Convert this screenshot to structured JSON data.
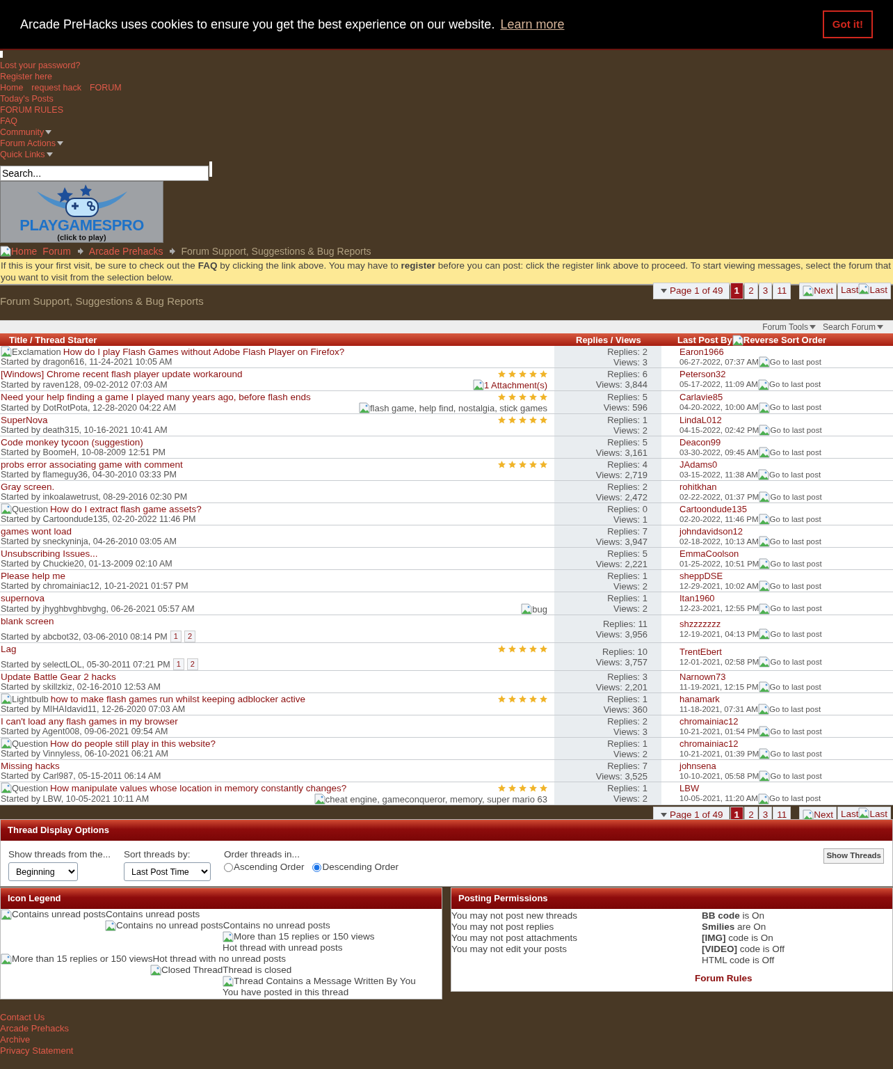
{
  "cookie_bar": {
    "message": "Arcade PreHacks uses cookies to ensure you get the best experience on our website.",
    "link": "Learn more",
    "button": "Got it!"
  },
  "nav_rows": [
    {
      "items": [
        {
          "label": "Lost your password?",
          "kind": "link"
        }
      ]
    },
    {
      "items": [
        {
          "label": "Register here",
          "kind": "link"
        }
      ]
    },
    {
      "items": [
        {
          "label": "Home",
          "kind": "link"
        },
        {
          "label": "request hack",
          "kind": "link"
        },
        {
          "label": "FORUM",
          "kind": "link"
        }
      ]
    },
    {
      "items": [
        {
          "label": "Today's Posts",
          "kind": "link"
        }
      ]
    },
    {
      "items": [
        {
          "label": "FORUM RULES",
          "kind": "link"
        }
      ]
    },
    {
      "items": [
        {
          "label": "FAQ",
          "kind": "link"
        }
      ]
    },
    {
      "items": [
        {
          "label": "Community",
          "kind": "menu"
        }
      ]
    },
    {
      "items": [
        {
          "label": "Forum Actions",
          "kind": "menu"
        }
      ]
    },
    {
      "items": [
        {
          "label": "Quick Links",
          "kind": "menu"
        }
      ]
    }
  ],
  "search": {
    "placeholder": "Search..."
  },
  "logo": {
    "title": "PLAYGAMESPRO",
    "subtitle": "(click to play)"
  },
  "breadcrumb": [
    {
      "label": "Home",
      "current": false
    },
    {
      "label": "Forum",
      "current": false
    },
    {
      "label": "Arcade Prehacks",
      "current": false
    },
    {
      "label": "Forum Support, Suggestions & Bug Reports",
      "current": true
    }
  ],
  "notice": "If this is your first visit, be sure to check out the **FAQ** by clicking the link above. You may have to **register** before you can post: click the register link above to proceed. To start viewing messages, select the forum that you want to visit from the selection below.",
  "forum_title": "Forum Support, Suggestions & Bug Reports",
  "pagination": {
    "label": "Page 1 of 49",
    "pages": [
      {
        "label": "1",
        "selected": true
      },
      {
        "label": "2",
        "selected": false
      },
      {
        "label": "3",
        "selected": false
      },
      {
        "label": "11",
        "selected": false
      }
    ],
    "next": "Next",
    "last_text": "Last",
    "last_alt": "Last"
  },
  "toolbar": [
    "Forum Tools",
    "Search Forum"
  ],
  "columns": {
    "title": "Title / Thread Starter",
    "replies": "Replies / Views",
    "last_post": "Last Post By",
    "sort_alt": "Reverse Sort Order"
  },
  "threads": [
    {
      "prefix": "Exclamation",
      "title": "How do I play Flash Games without Adobe Flash Player on Firefox?",
      "started": "Started by dragon616, 11-24-2021 10:05 AM",
      "replies": "Replies: 2",
      "views": "Views: 3",
      "last_by": "Earon1966",
      "last_date": "06-27-2022, 07:37 AM",
      "last_alt": "Go to last post"
    },
    {
      "title": "[Windows] Chrome recent flash player update workaround",
      "started": "Started by raven128, 09-02-2012 07:03 AM",
      "stars": 5,
      "attachment": "1 Attachment(s)",
      "replies": "Replies: 6",
      "views": "Views: 3,844",
      "last_by": "Peterson32",
      "last_date": "05-17-2022, 11:09 AM",
      "last_alt": "Go to last post"
    },
    {
      "title": "Need your help finding a game I played many years ago, before flash ends",
      "started": "Started by DotRotPota, 12-28-2020 04:22 AM",
      "stars": 5,
      "tags": "flash game, help find, nostalgia, stick games",
      "replies": "Replies: 5",
      "views": "Views: 596",
      "last_by": "Carlavie85",
      "last_date": "04-20-2022, 10:00 AM",
      "last_alt": "Go to last post"
    },
    {
      "title": "SuperNova",
      "started": "Started by death315, 10-16-2021 10:41 AM",
      "stars": 5,
      "replies": "Replies: 1",
      "views": "Views: 2",
      "last_by": "LindaL012",
      "last_date": "04-15-2022, 02:42 PM",
      "last_alt": "Go to last post"
    },
    {
      "title": "Code monkey tycoon (suggestion)",
      "started": "Started by BoomeH, 10-08-2009 12:51 PM",
      "replies": "Replies: 5",
      "views": "Views: 3,161",
      "last_by": "Deacon99",
      "last_date": "03-30-2022, 09:45 AM",
      "last_alt": "Go to last post"
    },
    {
      "title": "probs error associating game with comment",
      "started": "Started by flameguy36, 04-30-2010 03:33 PM",
      "stars": 5,
      "replies": "Replies: 4",
      "views": "Views: 2,719",
      "last_by": "JAdams0",
      "last_date": "03-15-2022, 11:38 AM",
      "last_alt": "Go to last post"
    },
    {
      "title": "Gray screen.",
      "started": "Started by inkoalawetrust, 08-29-2016 02:30 PM",
      "replies": "Replies: 2",
      "views": "Views: 2,472",
      "last_by": "rohitkhan",
      "last_date": "02-22-2022, 01:37 PM",
      "last_alt": "Go to last post"
    },
    {
      "prefix": "Question",
      "title": "How do I extract flash game assets?",
      "started": "Started by Cartoondude135, 02-20-2022 11:46 PM",
      "replies": "Replies: 0",
      "views": "Views: 1",
      "last_by": "Cartoondude135",
      "last_date": "02-20-2022, 11:46 PM",
      "last_alt": "Go to last post"
    },
    {
      "title": "games wont load",
      "started": "Started by sneckyninja, 04-26-2010 03:05 AM",
      "replies": "Replies: 7",
      "views": "Views: 3,947",
      "last_by": "johndavidson12",
      "last_date": "02-18-2022, 10:13 AM",
      "last_alt": "Go to last post"
    },
    {
      "title": "Unsubscribing Issues...",
      "started": "Started by Chuckie20, 01-13-2009 02:10 AM",
      "replies": "Replies: 5",
      "views": "Views: 2,221",
      "last_by": "EmmaCoolson",
      "last_date": "01-25-2022, 10:51 PM",
      "last_alt": "Go to last post"
    },
    {
      "title": "Please help me",
      "started": "Started by chromainiac12, 10-21-2021 01:57 PM",
      "replies": "Replies: 1",
      "views": "Views: 2",
      "last_by": "sheppDSE",
      "last_date": "12-29-2021, 10:02 AM",
      "last_alt": "Go to last post"
    },
    {
      "title": "supernova",
      "started": "Started by jhyghbvghbvghg, 06-26-2021 05:57 AM",
      "tags": "bug",
      "replies": "Replies: 1",
      "views": "Views: 2",
      "last_by": "Itan1960",
      "last_date": "12-23-2021, 12:55 PM",
      "last_alt": "Go to last post"
    },
    {
      "title": "blank screen",
      "started": "Started by abcbot32, 03-06-2010 08:14 PM",
      "pages": [
        "1",
        "2"
      ],
      "replies": "Replies: 11",
      "views": "Views: 3,956",
      "last_by": "shzzzzzzz",
      "last_date": "12-19-2021, 04:13 PM",
      "last_alt": "Go to last post"
    },
    {
      "title": "Lag",
      "started": "Started by selectLOL, 05-30-2011 07:21 PM",
      "stars": 5,
      "pages": [
        "1",
        "2"
      ],
      "replies": "Replies: 10",
      "views": "Views: 3,757",
      "last_by": "TrentEbert",
      "last_date": "12-01-2021, 02:58 PM",
      "last_alt": "Go to last post"
    },
    {
      "title": "Update Battle Gear 2 hacks",
      "started": "Started by skillzkiz, 02-16-2010 12:53 AM",
      "replies": "Replies: 3",
      "views": "Views: 2,201",
      "last_by": "Narnown73",
      "last_date": "11-19-2021, 12:15 PM",
      "last_alt": "Go to last post"
    },
    {
      "prefix": "Lightbulb",
      "title": "how to make flash games run whilst keeping adblocker active",
      "started": "Started by MIHAIdavid11, 12-26-2020 07:03 AM",
      "stars": 5,
      "replies": "Replies: 1",
      "views": "Views: 360",
      "last_by": "hanamark",
      "last_date": "11-18-2021, 07:31 AM",
      "last_alt": "Go to last post"
    },
    {
      "title": "I can't load any flash games in my browser",
      "started": "Started by Agent008, 09-06-2021 09:54 AM",
      "replies": "Replies: 2",
      "views": "Views: 3",
      "last_by": "chromainiac12",
      "last_date": "10-21-2021, 01:54 PM",
      "last_alt": "Go to last post"
    },
    {
      "prefix": "Question",
      "title": "How do people still play in this website?",
      "started": "Started by Vinnyless, 06-10-2021 06:21 AM",
      "replies": "Replies: 1",
      "views": "Views: 2",
      "last_by": "chromainiac12",
      "last_date": "10-21-2021, 01:39 PM",
      "last_alt": "Go to last post"
    },
    {
      "title": "Missing hacks",
      "started": "Started by Carl987, 05-15-2011 06:14 AM",
      "replies": "Replies: 7",
      "views": "Views: 3,525",
      "last_by": "johnsena",
      "last_date": "10-10-2021, 05:58 PM",
      "last_alt": "Go to last post"
    },
    {
      "prefix": "Question",
      "title": "How manipulate values whose location in memory constantly changes?",
      "started": "Started by LBW, 10-05-2021 10:11 AM",
      "stars": 5,
      "tags": "cheat engine, gameconqueror, memory, super mario 63",
      "replies": "Replies: 1",
      "views": "Views: 2",
      "last_by": "LBW",
      "last_date": "10-05-2021, 11:20 AM",
      "last_alt": "Go to last post"
    }
  ],
  "pagination_bottom": {
    "label": "Page 1 of 49",
    "pages": [
      {
        "label": "1",
        "selected": true
      },
      {
        "label": "2",
        "selected": false
      },
      {
        "label": "3",
        "selected": false
      },
      {
        "label": "11",
        "selected": false
      }
    ],
    "next": "Next",
    "last_text": "Last",
    "last_alt": "Last"
  },
  "display_options": {
    "title": "Thread Display Options",
    "fields": [
      {
        "label": "Show threads from the...",
        "value": "Beginning"
      },
      {
        "label": "Sort threads by:",
        "value": "Last Post Time"
      }
    ],
    "order_label": "Order threads in...",
    "order_options": [
      {
        "label": "Ascending Order",
        "selected": false
      },
      {
        "label": "Descending Order",
        "selected": true
      }
    ],
    "button": "Show Threads"
  },
  "icon_legend": {
    "title": "Icon Legend",
    "items": [
      {
        "alt": "Contains unread posts",
        "label": "Contains unread posts"
      },
      {
        "alt": "Contains no unread posts",
        "label": "Contains no unread posts"
      },
      {
        "alt": "More than 15 replies or 150 views",
        "label": "Hot thread with unread posts"
      },
      {
        "alt": "More than 15 replies or 150 views",
        "label": "Hot thread with no unread posts"
      },
      {
        "alt": "Closed Thread",
        "label": "Thread is closed"
      },
      {
        "alt": "Thread Contains a Message Written By You",
        "label": "You have posted in this thread"
      }
    ]
  },
  "permissions": {
    "title": "Posting Permissions",
    "rules": [
      "You may not post new threads",
      "You may not post replies",
      "You may not post attachments",
      "You may not edit your posts"
    ],
    "codes": [
      "**BB code** is On",
      "**Smilies** are On",
      "**[IMG]** code is On",
      "**[VIDEO]** code is Off",
      "HTML code is Off"
    ],
    "link": "Forum Rules"
  },
  "footer_links": [
    "Contact Us",
    "Arcade Prehacks",
    "Archive",
    "Privacy Statement"
  ]
}
